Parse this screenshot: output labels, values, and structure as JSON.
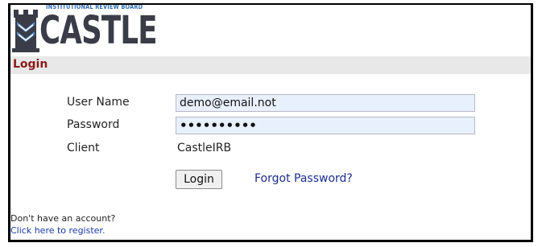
{
  "logo": {
    "subtitle": "INSTITUTIONAL REVIEW BOARD",
    "word": "CASTLE"
  },
  "section": {
    "title": "Login"
  },
  "form": {
    "username_label": "User Name",
    "username_value": "demo@email.not",
    "password_label": "Password",
    "password_value": "••••••••••",
    "client_label": "Client",
    "client_value": "CastleIRB",
    "login_button": "Login",
    "forgot_link": "Forgot Password?"
  },
  "footer": {
    "no_account": "Don't have an account?",
    "register_link": "Click here to register."
  },
  "colors": {
    "title": "#8b1a1a",
    "bar": "#e8e8e8",
    "field_bg": "#e8f0fe",
    "link": "#1a2c8c",
    "logo_text": "#3a3d48",
    "logo_sub": "#2f6fb3"
  }
}
